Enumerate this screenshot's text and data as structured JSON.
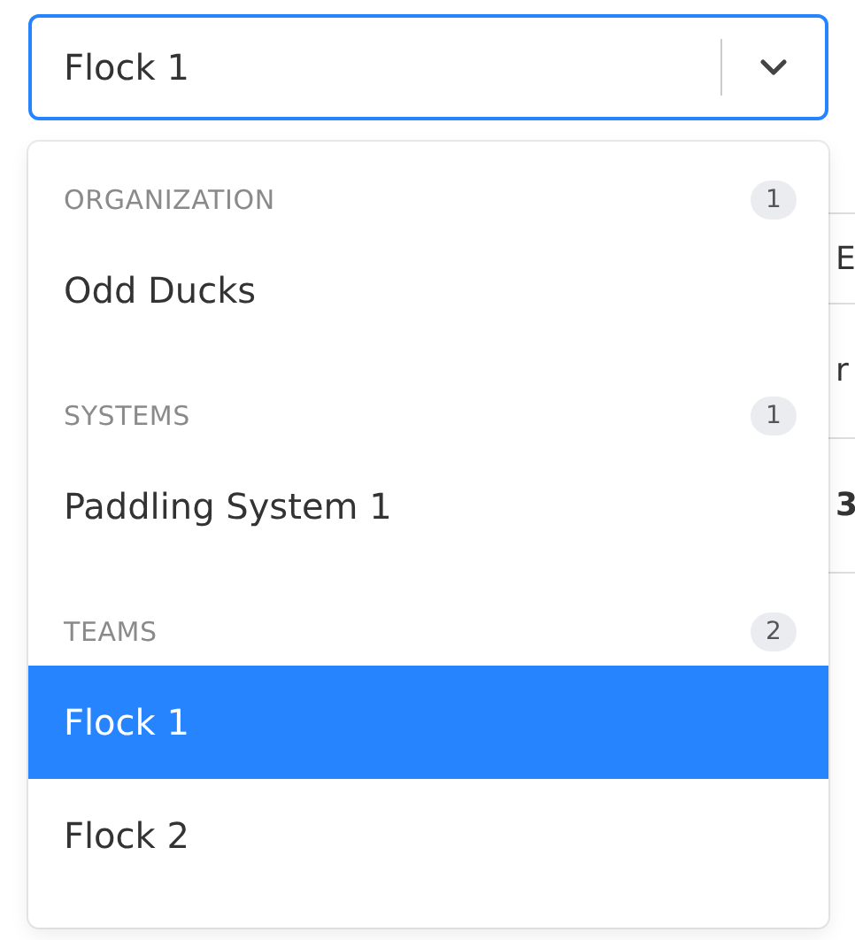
{
  "select": {
    "value": "Flock 1",
    "expanded": true
  },
  "menu": {
    "groups": [
      {
        "label": "ORGANIZATION",
        "count": "1",
        "options": [
          {
            "label": "Odd Ducks",
            "selected": false
          }
        ]
      },
      {
        "label": "SYSTEMS",
        "count": "1",
        "options": [
          {
            "label": "Paddling System 1",
            "selected": false
          }
        ]
      },
      {
        "label": "TEAMS",
        "count": "2",
        "options": [
          {
            "label": "Flock 1",
            "selected": true
          },
          {
            "label": "Flock 2",
            "selected": false
          }
        ]
      }
    ]
  },
  "background": {
    "texts": [
      {
        "text": "E",
        "bold": false
      },
      {
        "text": "r",
        "bold": false
      },
      {
        "text": "3",
        "bold": true
      }
    ]
  }
}
